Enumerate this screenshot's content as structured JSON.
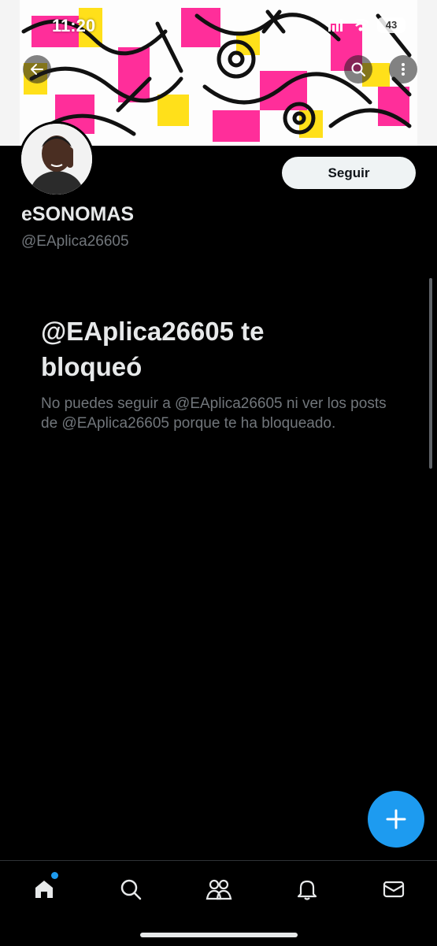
{
  "status_bar": {
    "time": "11:20",
    "battery": "43"
  },
  "profile": {
    "display_name": "eSONOMAS",
    "handle": "@EAplica26605",
    "follow_label": "Seguir"
  },
  "blocked": {
    "title": "@EAplica26605 te bloqueó",
    "description": "No puedes seguir a @EAplica26605 ni ver los posts de @EAplica26605 porque te ha bloqueado."
  },
  "colors": {
    "accent": "#1d9bf0",
    "background": "#000000",
    "muted_text": "#71767b"
  },
  "icons": {
    "back": "arrow-left-icon",
    "search": "search-icon",
    "more": "more-vertical-icon",
    "fab": "plus-icon",
    "home": "home-icon",
    "explore": "search-icon",
    "communities": "communities-icon",
    "notifications": "bell-icon",
    "messages": "mail-icon"
  }
}
